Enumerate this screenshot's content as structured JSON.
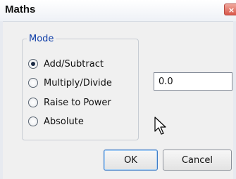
{
  "window": {
    "title": "Maths",
    "close_glyph": "×"
  },
  "mode_group": {
    "legend": "Mode",
    "options": [
      {
        "label": "Add/Subtract",
        "selected": true
      },
      {
        "label": "Multiply/Divide",
        "selected": false
      },
      {
        "label": "Raise to Power",
        "selected": false
      },
      {
        "label": "Absolute",
        "selected": false
      }
    ]
  },
  "value_input": {
    "value": "0.0"
  },
  "buttons": {
    "ok_label": "OK",
    "cancel_label": "Cancel"
  },
  "icons": {
    "close": "close-icon",
    "pointer": "mouse-pointer-icon"
  },
  "colors": {
    "legend_text": "#0f3ea8",
    "close_button": "#d9584b"
  }
}
